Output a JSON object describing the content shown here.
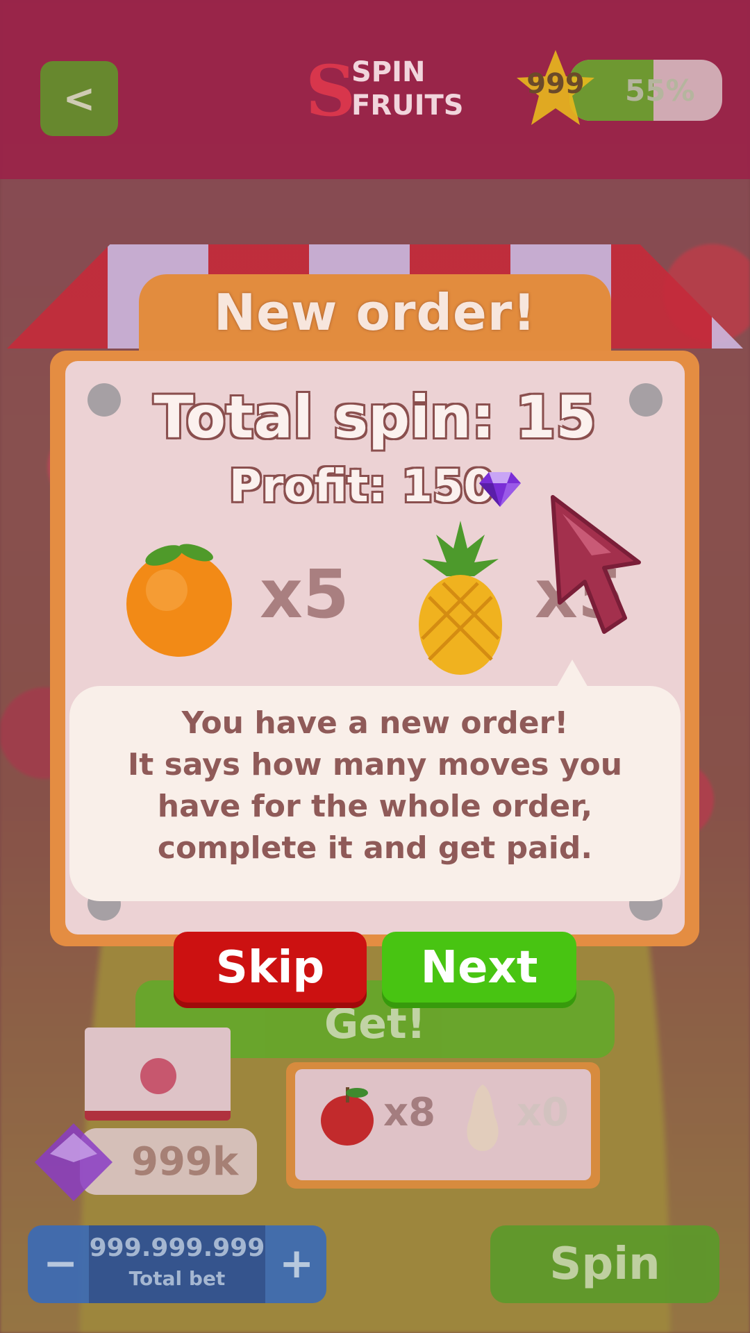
{
  "header": {
    "back_label": "<",
    "logo_line1": "SPIN",
    "logo_line2": "FRUITS",
    "logo_letter": "S",
    "stars": "999",
    "level_percent_label": "55%",
    "level_fraction": 0.55
  },
  "order_dialog": {
    "title": "New order!",
    "total_spin": "Total spin: 15",
    "profit": "Profit: 150",
    "items": [
      {
        "fruit": "orange",
        "count": "x5"
      },
      {
        "fruit": "pineapple",
        "count": "x5"
      }
    ]
  },
  "tooltip": {
    "line1": "You have a new order!",
    "line2": "It says how many moves you",
    "line3": "have for the whole order,",
    "line4": "complete it and get paid."
  },
  "buttons": {
    "skip": "Skip",
    "next": "Next"
  },
  "background_ui": {
    "get_label": "Get!",
    "apple_count": "x8",
    "pear_count": "x0",
    "gems": "999k",
    "total_bet_amount": "999.999.999",
    "total_bet_label": "Total bet",
    "minus": "−",
    "plus": "+",
    "spin_label": "Spin"
  },
  "colors": {
    "skip": "#cc1111",
    "next": "#48c412",
    "header": "#9a2349",
    "dialog_orange": "#e28c3e"
  }
}
